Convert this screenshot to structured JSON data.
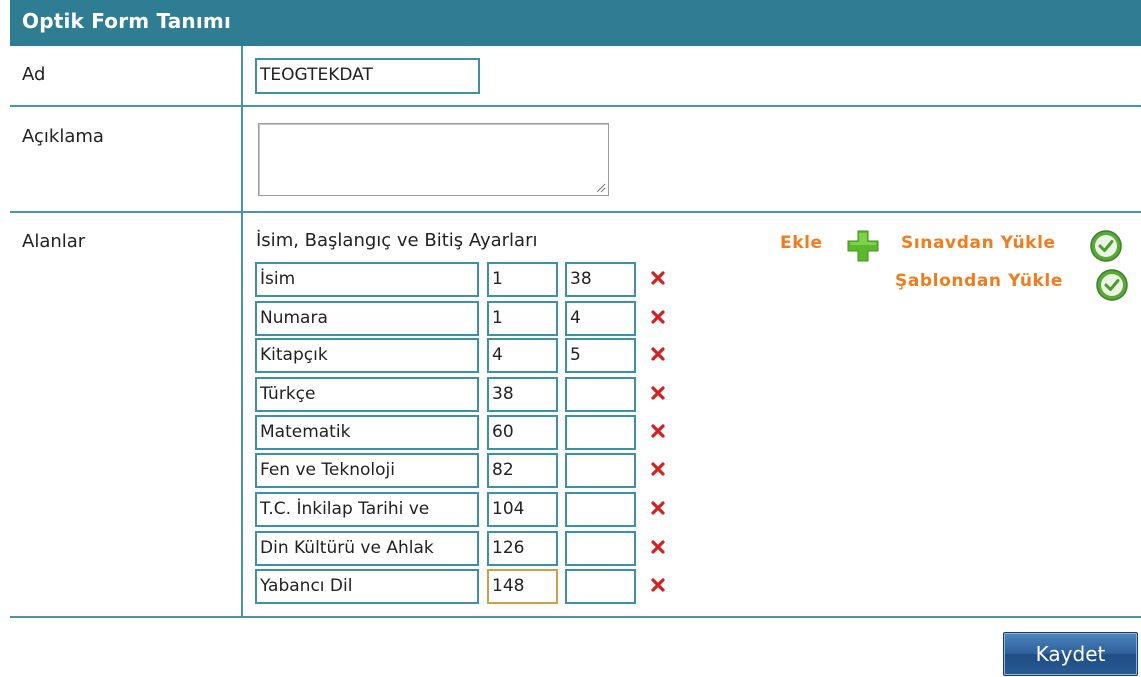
{
  "header": {
    "title": "Optik Form Tanımı"
  },
  "form": {
    "name_label": "Ad",
    "name_value": "TEOGTEKDAT",
    "description_label": "Açıklama",
    "description_value": "",
    "fields_label": "Alanlar"
  },
  "fields_section": {
    "title": "İsim, Başlangıç ve Bitiş Ayarları",
    "rows": [
      {
        "name": "İsim",
        "start": "1",
        "end": "38"
      },
      {
        "name": "Numara",
        "start": "1",
        "end": "4"
      },
      {
        "name": "Kitapçık",
        "start": "4",
        "end": "5"
      },
      {
        "name": "Türkçe",
        "start": "38",
        "end": ""
      },
      {
        "name": "Matematik",
        "start": "60",
        "end": ""
      },
      {
        "name": "Fen ve Teknoloji",
        "start": "82",
        "end": ""
      },
      {
        "name": "T.C. İnkilap Tarihi ve",
        "start": "104",
        "end": ""
      },
      {
        "name": "Din Kültürü ve Ahlak",
        "start": "126",
        "end": ""
      },
      {
        "name": "Yabancı Dil",
        "start": "148",
        "end": ""
      }
    ]
  },
  "actions": {
    "add_label": "Ekle",
    "load_from_exam_label": "Sınavdan Yükle",
    "load_from_template_label": "Şablondan Yükle"
  },
  "footer": {
    "save_label": "Kaydet"
  },
  "icons": {
    "delete": "close-icon",
    "add": "plus-icon",
    "load": "check-icon"
  },
  "colors": {
    "header_bg": "#2e7d93",
    "border": "#4a94ab",
    "action_text": "#f07c1e",
    "delete_red": "#d42020",
    "add_green": "#5cb82e",
    "button_blue": "#2c5f9a"
  }
}
